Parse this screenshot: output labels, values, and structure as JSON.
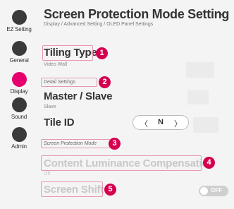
{
  "sidebar": {
    "items": [
      {
        "label": "EZ Setting"
      },
      {
        "label": "General"
      },
      {
        "label": "Display",
        "active": true
      },
      {
        "label": "Sound"
      },
      {
        "label": "Admin"
      }
    ]
  },
  "header": {
    "title": "Screen Protection Mode Setting",
    "breadcrumb": "Display / Advanced Setting / OLED Panel Settings"
  },
  "rows": {
    "tiling_type": {
      "label": "Tiling Type",
      "value": "Video Wall",
      "marker": "1"
    },
    "detail_settings": {
      "label": "Detail Settings",
      "marker": "2"
    },
    "master_slave": {
      "label": "Master / Slave",
      "value": "Slave"
    },
    "tile_id": {
      "label": "Tile ID",
      "left_arrow": "〈",
      "value": "N",
      "right_arrow": "〉"
    },
    "screen_protection_mode": {
      "label": "Screen Protection Mode",
      "marker": "3"
    },
    "content_luminance": {
      "label": "Content Luminance Compensation",
      "value": "Off",
      "marker": "4"
    },
    "screen_shift": {
      "label": "Screen Shift",
      "toggle": "OFF",
      "marker": "5"
    }
  },
  "colors": {
    "accent": "#e6006e",
    "marker": "#d4004f",
    "highlight_border": "#e898ae"
  }
}
